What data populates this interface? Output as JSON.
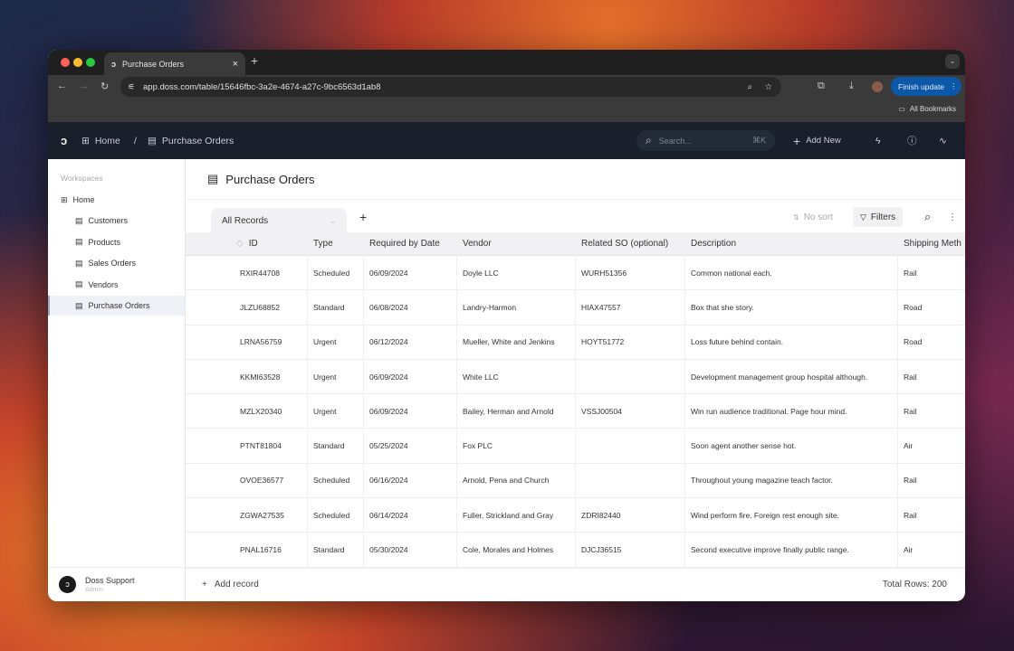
{
  "browser": {
    "tab_title": "Purchase Orders",
    "url": "app.doss.com/table/15646fbc-3a2e-4674-a27c-9bc6563d1ab8",
    "finish_update": "Finish update",
    "bookmarks": "All Bookmarks"
  },
  "header": {
    "home": "Home",
    "separator": "/",
    "page": "Purchase Orders",
    "search_placeholder": "Search...",
    "shortcut": "⌘K",
    "add_new": "Add New"
  },
  "sidebar": {
    "section": "Workspaces",
    "home": "Home",
    "items": [
      {
        "label": "Customers"
      },
      {
        "label": "Products"
      },
      {
        "label": "Sales Orders"
      },
      {
        "label": "Vendors"
      },
      {
        "label": "Purchase Orders",
        "active": true
      }
    ],
    "user": {
      "name": "Doss Support",
      "role": "Admin"
    }
  },
  "main": {
    "title": "Purchase Orders",
    "view": "All Records",
    "sort": "No sort",
    "filters": "Filters",
    "columns": [
      "ID",
      "Type",
      "Required by Date",
      "Vendor",
      "Related SO (optional)",
      "Description",
      "Shipping Meth"
    ],
    "rows": [
      [
        "RXIR44708",
        "Scheduled",
        "06/09/2024",
        "Doyle LLC",
        "WURH51356",
        "Common national each.",
        "Rail"
      ],
      [
        "JLZU68852",
        "Standard",
        "06/08/2024",
        "Landry-Harmon",
        "HIAX47557",
        "Box that she story.",
        "Road"
      ],
      [
        "LRNA56759",
        "Urgent",
        "06/12/2024",
        "Mueller, White and Jenkins",
        "HOYT51772",
        "Loss future behind contain.",
        "Road"
      ],
      [
        "KKMI63528",
        "Urgent",
        "06/09/2024",
        "White LLC",
        "",
        "Development management group hospital although.",
        "Rail"
      ],
      [
        "MZLX20340",
        "Urgent",
        "06/09/2024",
        "Bailey, Herman and Arnold",
        "VSSJ00504",
        "Win run audience traditional. Page hour mind.",
        "Rail"
      ],
      [
        "PTNT81804",
        "Standard",
        "05/25/2024",
        "Fox PLC",
        "",
        "Soon agent another sense hot.",
        "Air"
      ],
      [
        "OVOE36577",
        "Scheduled",
        "06/16/2024",
        "Arnold, Pena and Church",
        "",
        "Throughout young magazine teach factor.",
        "Rail"
      ],
      [
        "ZGWA27535",
        "Scheduled",
        "06/14/2024",
        "Fuller, Strickland and Gray",
        "ZDRI82440",
        "Wind perform fire. Foreign rest enough site.",
        "Rail"
      ],
      [
        "PNAL16716",
        "Standard",
        "05/30/2024",
        "Cole, Morales and Holmes",
        "DJCJ36515",
        "Second executive improve finally public range.",
        "Air"
      ]
    ],
    "add_record": "Add record",
    "total_rows": "Total Rows: 200"
  },
  "colors": {
    "app_header": "#19202b",
    "finish_update": "#0b57a8"
  }
}
